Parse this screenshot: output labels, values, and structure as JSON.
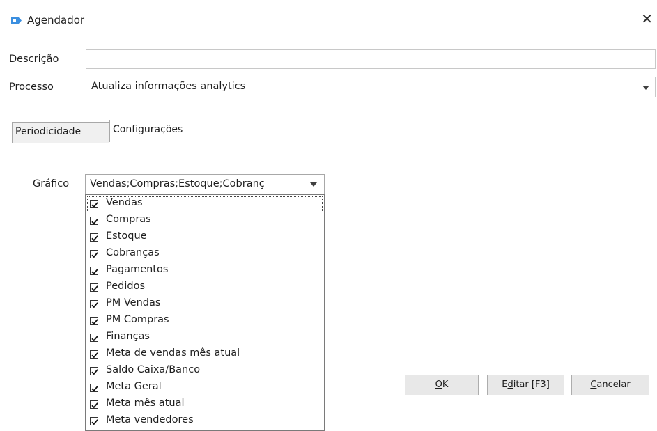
{
  "window": {
    "title": "Agendador",
    "close_glyph": "✕"
  },
  "form": {
    "descricao_label": "Descrição",
    "descricao_value": "",
    "processo_label": "Processo",
    "processo_value": "Atualiza informações analytics"
  },
  "tabs": [
    {
      "label": "Periodicidade",
      "active": false
    },
    {
      "label": "Configurações",
      "active": true
    }
  ],
  "grafico": {
    "label": "Gráfico",
    "value": "Vendas;Compras;Estoque;Cobranç",
    "options": [
      {
        "label": "Vendas",
        "checked": true
      },
      {
        "label": "Compras",
        "checked": true
      },
      {
        "label": "Estoque",
        "checked": true
      },
      {
        "label": "Cobranças",
        "checked": true
      },
      {
        "label": "Pagamentos",
        "checked": true
      },
      {
        "label": "Pedidos",
        "checked": true
      },
      {
        "label": "PM Vendas",
        "checked": true
      },
      {
        "label": "PM Compras",
        "checked": true
      },
      {
        "label": "Finanças",
        "checked": true
      },
      {
        "label": "Meta de vendas mês atual",
        "checked": true
      },
      {
        "label": "Saldo Caixa/Banco",
        "checked": true
      },
      {
        "label": "Meta Geral",
        "checked": true
      },
      {
        "label": "Meta mês atual",
        "checked": true
      },
      {
        "label": "Meta vendedores",
        "checked": true
      }
    ]
  },
  "buttons": {
    "ok": {
      "mnemonic": "O",
      "rest": "K"
    },
    "editar": {
      "pre": "E",
      "mnemonic": "d",
      "rest": "itar [F3]"
    },
    "cancelar": {
      "mnemonic": "C",
      "rest": "ancelar"
    }
  },
  "colors": {
    "app_icon": "#3b8fe0"
  }
}
